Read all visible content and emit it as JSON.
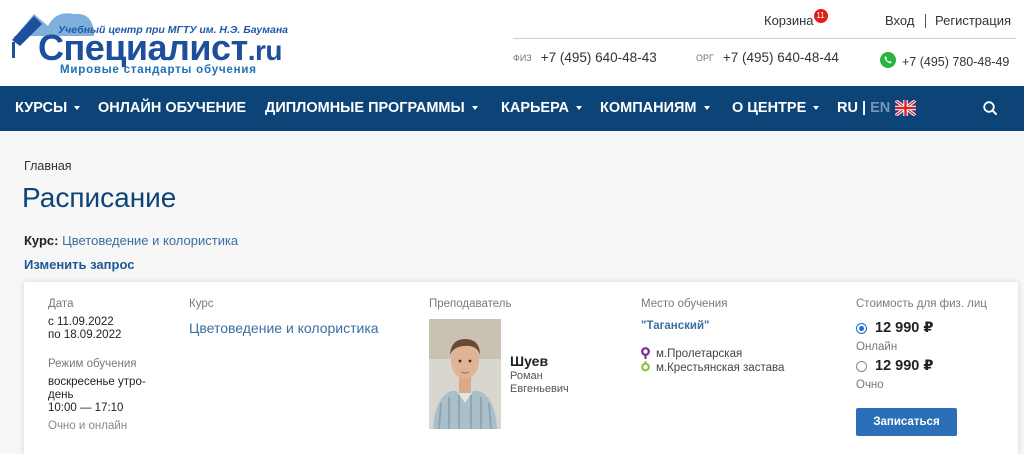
{
  "logo": {
    "top_text": "Учебный центр при МГТУ им. Н.Э. Баумана",
    "brand": "Специалист",
    "brand_suffix": ".ru",
    "slogan": "Мировые стандарты обучения"
  },
  "header": {
    "cart_label": "Корзина",
    "cart_count": "11",
    "login_label": "Вход",
    "register_label": "Регистрация",
    "phones": [
      {
        "label": "ФИЗ",
        "number": "+7 (495) 640-48-43"
      },
      {
        "label": "ОРГ",
        "number": "+7 (495) 640-48-44"
      },
      {
        "label": "",
        "number": "+7 (495) 780-48-49",
        "icon": "whatsapp-icon"
      }
    ]
  },
  "nav": {
    "items": [
      {
        "label": "КУРСЫ",
        "dropdown": true
      },
      {
        "label": "ОНЛАЙН ОБУЧЕНИЕ",
        "dropdown": false
      },
      {
        "label": "ДИПЛОМНЫЕ ПРОГРАММЫ",
        "dropdown": true
      },
      {
        "label": "КАРЬЕРА",
        "dropdown": true
      },
      {
        "label": "КОМПАНИЯМ",
        "dropdown": true
      },
      {
        "label": "О ЦЕНТРЕ",
        "dropdown": true
      }
    ],
    "lang_ru": "RU",
    "lang_sep": "|",
    "lang_en": "EN",
    "flag_icon": "uk-flag-icon",
    "search_icon": "search-icon"
  },
  "breadcrumb": "Главная",
  "page_title": "Расписание",
  "course_filter": {
    "label": "Курс:",
    "value": "Цветоведение и колористика"
  },
  "change_query": "Изменить запрос",
  "session": {
    "date_label": "Дата",
    "date_from": "с 11.09.2022",
    "date_to": "по 18.09.2022",
    "mode_label": "Режим обучения",
    "mode_line1": "воскресенье утро-",
    "mode_line2": "день",
    "mode_time": "10:00 — 17:10",
    "mode_format": "Очно и онлайн",
    "course_label": "Курс",
    "course_value": "Цветоведение и колористика",
    "teacher_label": "Преподаватель",
    "teacher_last": "Шуев",
    "teacher_first": "Роман",
    "teacher_middle": "Евгеньевич",
    "place_label": "Место обучения",
    "place_name": "\"Таганский\"",
    "metro": [
      "м.Пролетарская",
      "м.Крестьянская застава"
    ],
    "metro_colors": [
      "#7b2d8f",
      "#8dc63f"
    ],
    "price_label": "Стоимость для физ. лиц",
    "prices": [
      {
        "value": "12 990 ₽",
        "mode": "Онлайн",
        "selected": true
      },
      {
        "value": "12 990 ₽",
        "mode": "Очно",
        "selected": false
      }
    ],
    "enroll_button": "Записаться"
  },
  "colors": {
    "nav_bg": "#0c4477",
    "title": "#0c4477",
    "link": "#3b6fa0",
    "button": "#2a6fb7",
    "badge": "#e11d1d",
    "whatsapp": "#2bb441"
  }
}
